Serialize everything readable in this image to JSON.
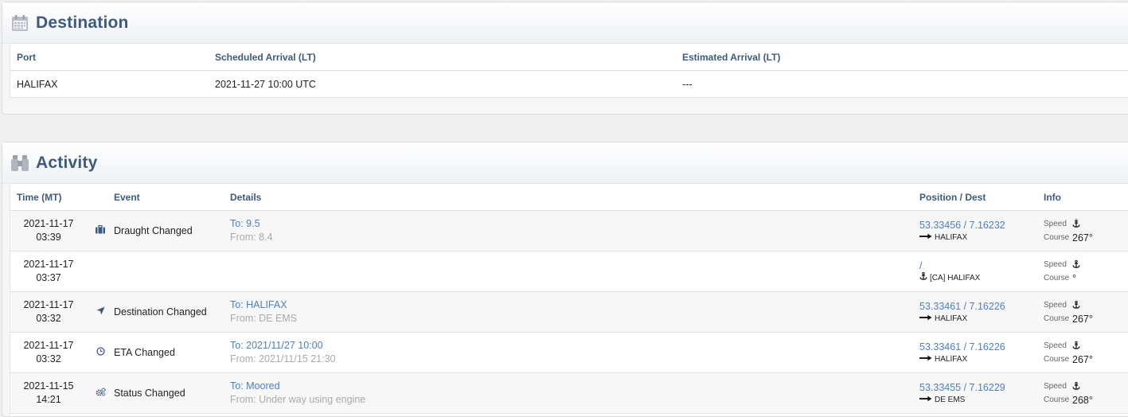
{
  "destination": {
    "title": "Destination",
    "columns": [
      "Port",
      "Scheduled Arrival (LT)",
      "Estimated Arrival (LT)"
    ],
    "row": {
      "port": "HALIFAX",
      "scheduled": "2021-11-27 10:00 UTC",
      "estimated": "---"
    }
  },
  "activity": {
    "title": "Activity",
    "columns": [
      "Time (MT)",
      "Event",
      "Details",
      "Position / Dest",
      "Info"
    ],
    "rows": [
      {
        "date": "2021-11-17",
        "time": "03:39",
        "icon": "briefcase-icon",
        "event": "Draught Changed",
        "to": "To: 9.5",
        "from": "From: 8.4",
        "coord": "53.33456 / 7.16232",
        "dest": "HALIFAX",
        "dest_icon": "arrow-right-icon",
        "speed_label": "Speed",
        "course_label": "Course",
        "course": "267°"
      },
      {
        "date": "2021-11-17",
        "time": "03:37",
        "icon": "",
        "event": "",
        "to": "",
        "from": "",
        "coord": "/",
        "dest": "[CA] HALIFAX",
        "dest_icon": "anchor-icon",
        "speed_label": "Speed",
        "course_label": "Course",
        "course": "°"
      },
      {
        "date": "2021-11-17",
        "time": "03:32",
        "icon": "navigation-arrow-icon",
        "event": "Destination Changed",
        "to": "To: HALIFAX",
        "from": "From: DE EMS",
        "coord": "53.33461 / 7.16226",
        "dest": "HALIFAX",
        "dest_icon": "arrow-right-icon",
        "speed_label": "Speed",
        "course_label": "Course",
        "course": "267°"
      },
      {
        "date": "2021-11-17",
        "time": "03:32",
        "icon": "clock-icon",
        "event": "ETA Changed",
        "to": "To: 2021/11/27 10:00",
        "from": "From: 2021/11/15 21:30",
        "coord": "53.33461 / 7.16226",
        "dest": "HALIFAX",
        "dest_icon": "arrow-right-icon",
        "speed_label": "Speed",
        "course_label": "Course",
        "course": "267°"
      },
      {
        "date": "2021-11-15",
        "time": "14:21",
        "icon": "gears-icon",
        "event": "Status Changed",
        "to": "To: Moored",
        "from": "From: Under way using engine",
        "coord": "53.33455 / 7.16229",
        "dest": "DE EMS",
        "dest_icon": "arrow-right-icon",
        "speed_label": "Speed",
        "course_label": "Course",
        "course": "268°"
      }
    ]
  },
  "colors": {
    "title": "#3d5a80",
    "link": "#4d7fc2",
    "muted": "#aaaaaa"
  }
}
